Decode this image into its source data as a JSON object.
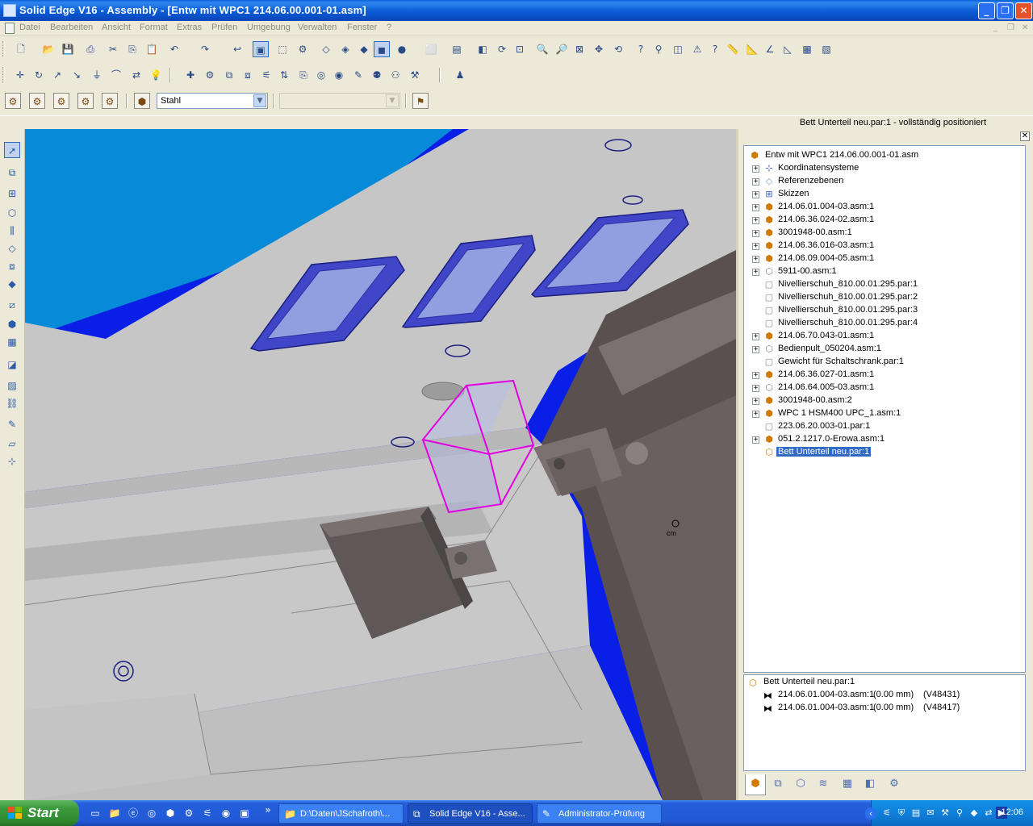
{
  "window": {
    "title": "Solid Edge V16 - Assembly - [Entw mit WPC1 214.06.00.001-01.asm]",
    "min": "_",
    "max": "❐",
    "close": "✕"
  },
  "menu": [
    "Datei",
    "Bearbeiten",
    "Ansicht",
    "Format",
    "Extras",
    "Prüfen",
    "Umgebung",
    "Verwalten",
    "Fenster",
    "?"
  ],
  "mdi_controls": {
    "min": "_",
    "restore": "❐",
    "close": "✕"
  },
  "toolbar": {
    "material_combo": "Stahl",
    "second_combo": ""
  },
  "status": "Bett Unterteil neu.par:1 - vollständig positioniert",
  "panel": {
    "close": "✕"
  },
  "tree": {
    "root": "Entw mit WPC1 214.06.00.001-01.asm",
    "items": [
      {
        "label": "Koordinatensysteme",
        "icon": "coord-icon",
        "expand": "+"
      },
      {
        "label": "Referenzebenen",
        "icon": "plane-icon",
        "expand": "+"
      },
      {
        "label": "Skizzen",
        "icon": "sketch-icon",
        "expand": "+"
      },
      {
        "label": "214.06.01.004-03.asm:1",
        "icon": "assembly-icon",
        "expand": "+"
      },
      {
        "label": "214.06.36.024-02.asm:1",
        "icon": "assembly-icon",
        "expand": "+"
      },
      {
        "label": "3001948-00.asm:1",
        "icon": "assembly-icon",
        "expand": "+"
      },
      {
        "label": "214.06.36.016-03.asm:1",
        "icon": "assembly-icon",
        "expand": "+"
      },
      {
        "label": "214.06.09.004-05.asm:1",
        "icon": "assembly-icon",
        "expand": "+"
      },
      {
        "label": "5911-00.asm:1",
        "icon": "assembly-hidden-icon",
        "expand": "+"
      },
      {
        "label": "Nivellierschuh_810.00.01.295.par:1",
        "icon": "part-icon",
        "expand": ""
      },
      {
        "label": "Nivellierschuh_810.00.01.295.par:2",
        "icon": "part-icon",
        "expand": ""
      },
      {
        "label": "Nivellierschuh_810.00.01.295.par:3",
        "icon": "part-icon",
        "expand": ""
      },
      {
        "label": "Nivellierschuh_810.00.01.295.par:4",
        "icon": "part-icon",
        "expand": ""
      },
      {
        "label": "214.06.70.043-01.asm:1",
        "icon": "assembly-icon",
        "expand": "+"
      },
      {
        "label": "Bedienpult_050204.asm:1",
        "icon": "assembly-hidden-icon",
        "expand": "+"
      },
      {
        "label": "Gewicht für Schaltschrank.par:1",
        "icon": "part-icon",
        "expand": ""
      },
      {
        "label": "214.06.36.027-01.asm:1",
        "icon": "assembly-icon",
        "expand": "+"
      },
      {
        "label": "214.06.64.005-03.asm:1",
        "icon": "assembly-hidden-icon",
        "expand": "+"
      },
      {
        "label": "3001948-00.asm:2",
        "icon": "assembly-icon",
        "expand": "+"
      },
      {
        "label": "WPC 1 HSM400 UPC_1.asm:1",
        "icon": "assembly-icon",
        "expand": "+"
      },
      {
        "label": "223.06.20.003-01.par:1",
        "icon": "part-icon",
        "expand": ""
      },
      {
        "label": "051.2.1217.0-Erowa.asm:1",
        "icon": "assembly-icon",
        "expand": "+"
      },
      {
        "label": "Bett Unterteil neu.par:1",
        "icon": "part-selected-icon",
        "expand": "",
        "selected": true
      }
    ]
  },
  "relationships": {
    "header": "Bett Unterteil neu.par:1",
    "rows": [
      {
        "part": "214.06.01.004-03.asm:1",
        "offset": "(0.00 mm)",
        "id": "(V48431)"
      },
      {
        "part": "214.06.01.004-03.asm:1",
        "offset": "(0.00 mm)",
        "id": "(V48417)"
      }
    ]
  },
  "viewport": {
    "cm_label": "cm"
  },
  "taskbar": {
    "start": "Start",
    "quick_more": "»",
    "tasks": [
      {
        "label": "D:\\Daten\\JSchafroth\\...",
        "icon": "folder-icon"
      },
      {
        "label": "Solid Edge V16 - Asse...",
        "icon": "solid-edge-icon",
        "active": true
      },
      {
        "label": "Administrator-Prüfung",
        "icon": "edit-icon"
      }
    ],
    "clock": "12:06"
  },
  "colors": {
    "accent": "#316ac5",
    "viewport_bg": "#0a1fe6",
    "selection_box": "#e000e0",
    "title_blue": "#0b5bd6"
  }
}
